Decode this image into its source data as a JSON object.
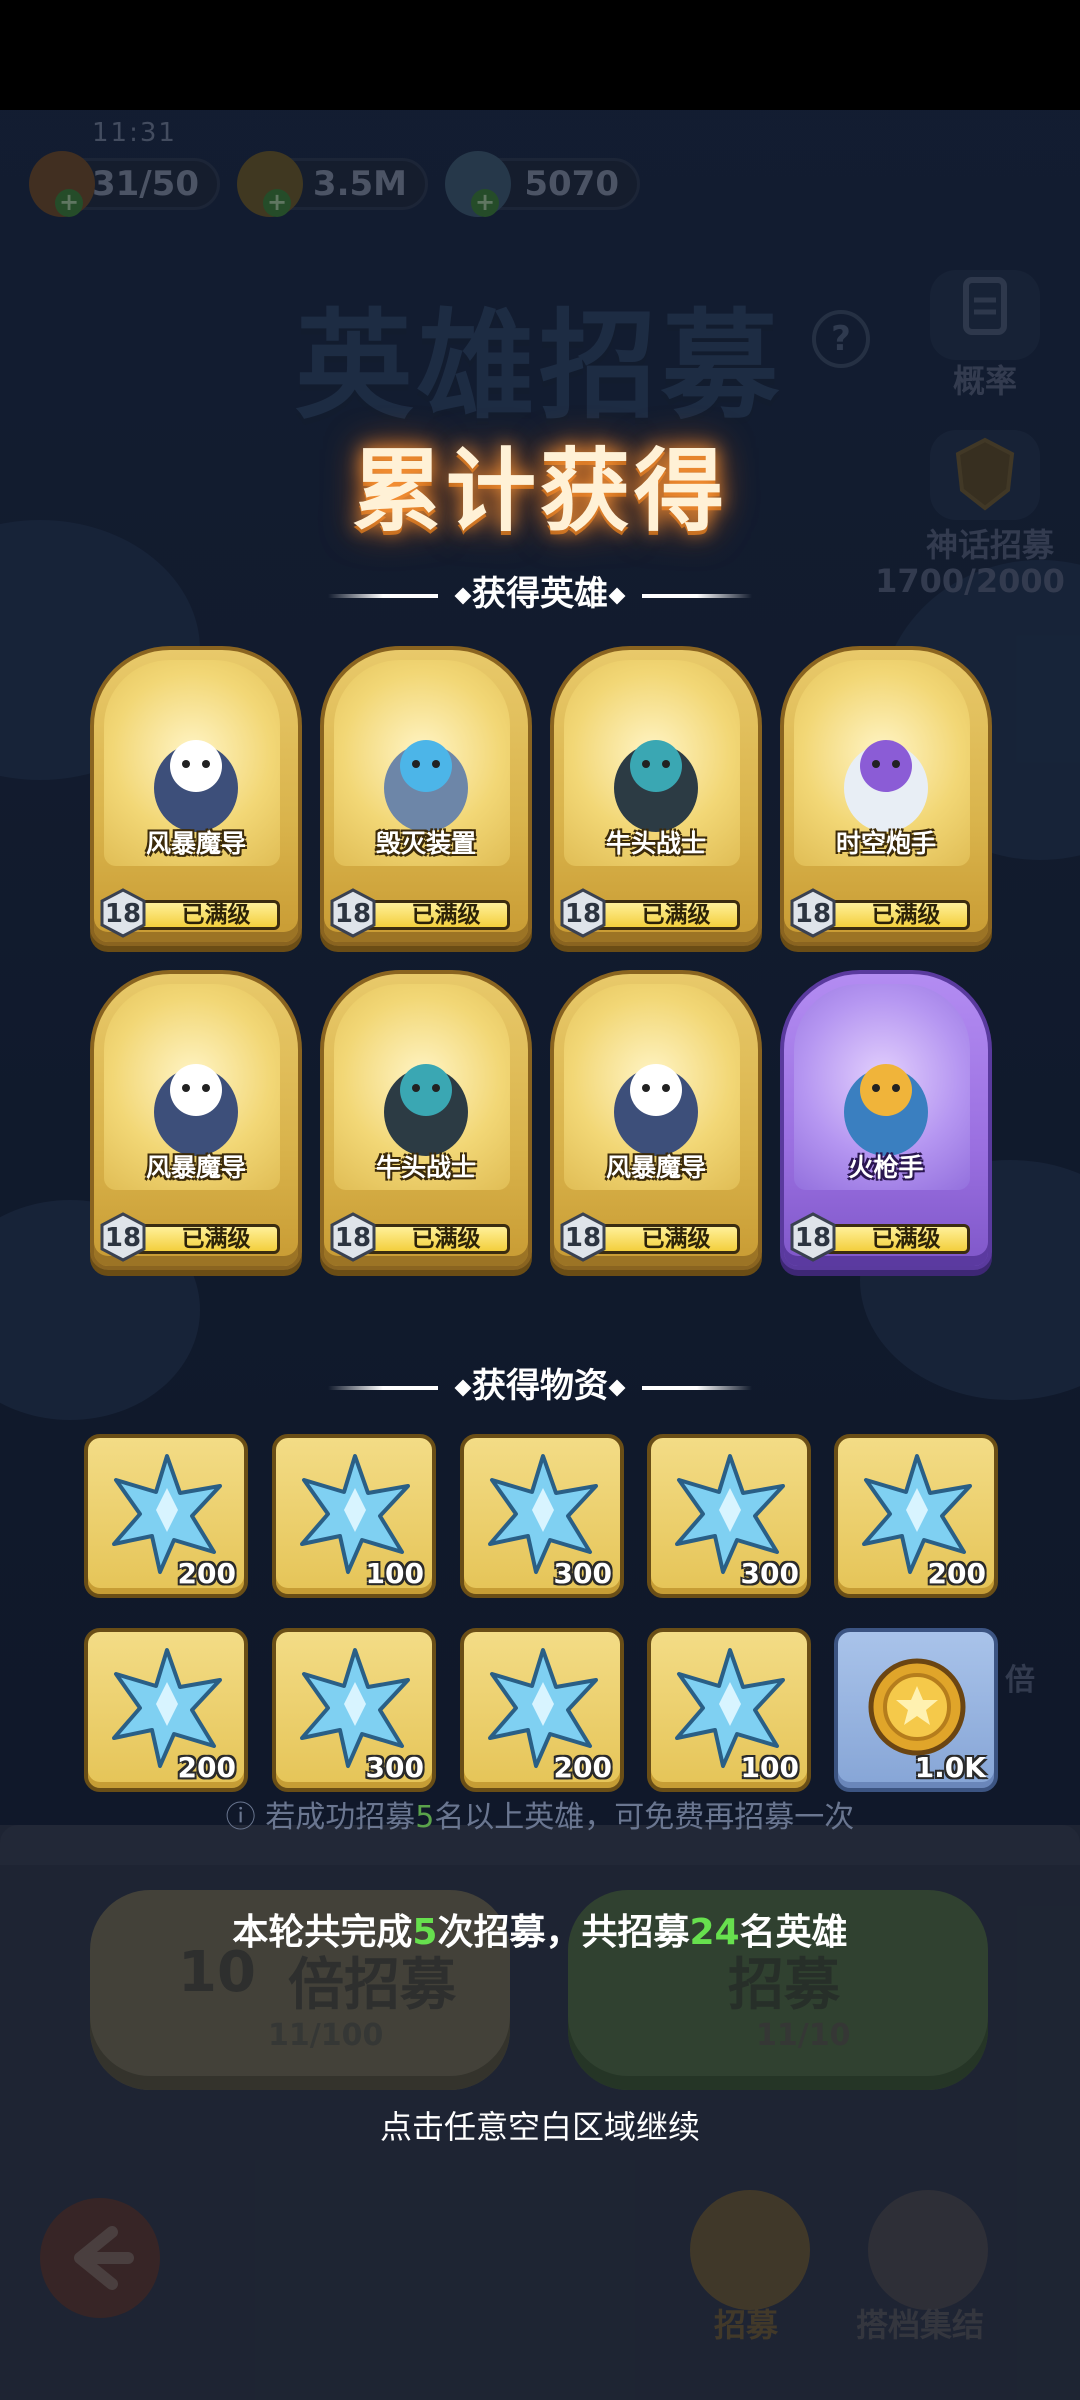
{
  "status_bar": {
    "time": "11:31"
  },
  "resources": [
    {
      "name": "stamina",
      "value": "31/50",
      "icon": "flame-coin-icon",
      "color": "#d88a2a"
    },
    {
      "name": "gold",
      "value": "3.5M",
      "icon": "gold-coin-icon",
      "color": "#c9a032"
    },
    {
      "name": "crystal",
      "value": "5070",
      "icon": "blue-crystal-icon",
      "color": "#6fb0d8"
    }
  ],
  "background": {
    "title": "英雄招募",
    "side_probability_label": "概率",
    "side_myth_label": "神话招募",
    "side_myth_progress": "1700/2000",
    "multiplier_hint": "倍",
    "ten_pull_label": "10",
    "ten_pull_suffix": "倍招募",
    "ten_pull_cost": "11/100",
    "single_pull_label": "招募",
    "single_pull_cost": "11/10",
    "nav_recruit": "招募",
    "nav_partner": "搭档集结",
    "free_note_pre": "ⓘ 若成功招募",
    "free_note_num": "5",
    "free_note_post": "名以上英雄，可免费再招募一次"
  },
  "result": {
    "title": "累计获得",
    "heroes_header": "获得英雄",
    "items_header": "获得物资",
    "summary_pre": "本轮共完成",
    "summary_count": "5",
    "summary_mid": "次招募，共招募",
    "summary_heroes": "24",
    "summary_post": "名英雄",
    "continue_hint": "点击任意空白区域继续"
  },
  "heroes": [
    {
      "name": "风暴魔导",
      "level": "18",
      "status": "已满级",
      "rarity": "gold",
      "icon": "storm-mage-icon"
    },
    {
      "name": "毁灭装置",
      "level": "18",
      "status": "已满级",
      "rarity": "gold",
      "icon": "destroyer-robot-icon"
    },
    {
      "name": "牛头战士",
      "level": "18",
      "status": "已满级",
      "rarity": "gold",
      "icon": "minotaur-warrior-icon"
    },
    {
      "name": "时空炮手",
      "level": "18",
      "status": "已满级",
      "rarity": "gold",
      "icon": "spacetime-gunner-icon"
    },
    {
      "name": "风暴魔导",
      "level": "18",
      "status": "已满级",
      "rarity": "gold",
      "icon": "storm-mage-icon"
    },
    {
      "name": "牛头战士",
      "level": "18",
      "status": "已满级",
      "rarity": "gold",
      "icon": "minotaur-warrior-icon"
    },
    {
      "name": "风暴魔导",
      "level": "18",
      "status": "已满级",
      "rarity": "gold",
      "icon": "storm-mage-icon"
    },
    {
      "name": "火枪手",
      "level": "18",
      "status": "已满级",
      "rarity": "purple",
      "icon": "musketeer-icon"
    }
  ],
  "items": [
    {
      "qty": "200",
      "icon": "blue-crystal-icon"
    },
    {
      "qty": "100",
      "icon": "blue-crystal-icon"
    },
    {
      "qty": "300",
      "icon": "blue-crystal-icon"
    },
    {
      "qty": "300",
      "icon": "blue-crystal-icon"
    },
    {
      "qty": "200",
      "icon": "blue-crystal-icon"
    },
    {
      "qty": "200",
      "icon": "blue-crystal-icon"
    },
    {
      "qty": "300",
      "icon": "blue-crystal-icon"
    },
    {
      "qty": "200",
      "icon": "blue-crystal-icon"
    },
    {
      "qty": "100",
      "icon": "blue-crystal-icon"
    },
    {
      "qty": "1.0K",
      "icon": "gold-coin-icon"
    }
  ]
}
